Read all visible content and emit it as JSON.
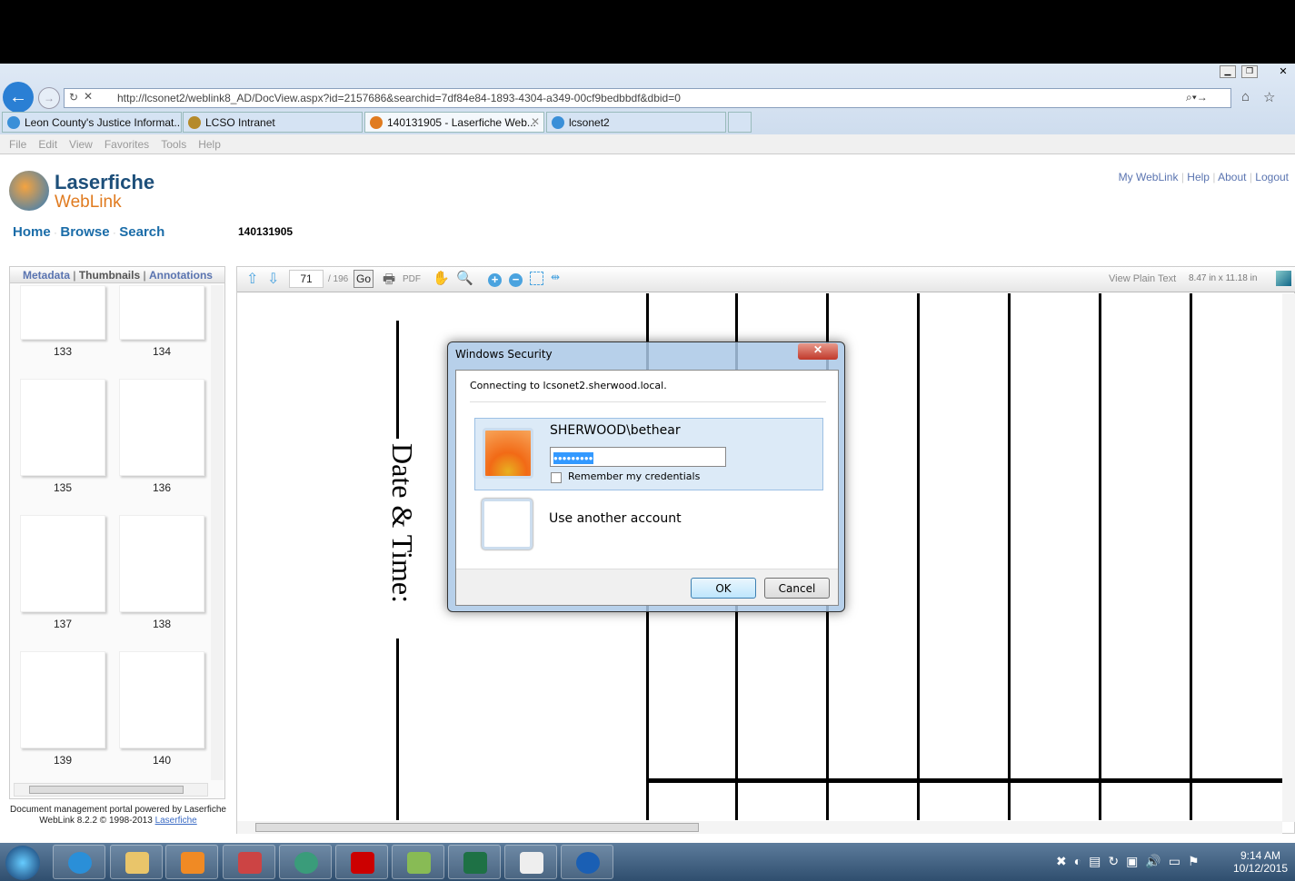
{
  "browser": {
    "url": "http://lcsonet2/weblink8_AD/DocView.aspx?id=2157686&searchid=7df84e84-1893-4304-a349-00cf9bedbbdf&dbid=0",
    "tabs": [
      {
        "label": "Leon County's Justice Informat..."
      },
      {
        "label": "LCSO Intranet"
      },
      {
        "label": "140131905 - Laserfiche Web...",
        "active": true
      },
      {
        "label": "lcsonet2"
      }
    ],
    "menu": [
      "File",
      "Edit",
      "View",
      "Favorites",
      "Tools",
      "Help"
    ]
  },
  "header": {
    "logo_top": "Laserfiche",
    "logo_bottom": "WebLink",
    "top_links": [
      "My WebLink",
      "Help",
      "About",
      "Logout"
    ],
    "nav": [
      "Home",
      "Browse",
      "Search"
    ],
    "doc_name": "140131905"
  },
  "left_panel": {
    "tabs": [
      "Metadata",
      "Thumbnails",
      "Annotations"
    ],
    "thumbnails": [
      "133",
      "134",
      "135",
      "136",
      "137",
      "138",
      "139",
      "140"
    ],
    "footer_line1": "Document management portal powered by Laserfiche",
    "footer_line2": "WebLink 8.2.2 © 1998-2013 ",
    "footer_link": "Laserfiche"
  },
  "viewer": {
    "page": "71",
    "page_total": "/ 196",
    "go": "Go",
    "pdf": "PDF",
    "view_plain_text": "View Plain Text",
    "page_size": "8.47 in x 11.18 in",
    "doc_text": "Date & Time:"
  },
  "dialog": {
    "title": "Windows Security",
    "connecting": "Connecting to lcsonet2.sherwood.local.",
    "username": "SHERWOOD\\bethear",
    "password": "●●●●●●●●●",
    "remember": "Remember my credentials",
    "remember_checked": false,
    "other": "Use another account",
    "ok": "OK",
    "cancel": "Cancel"
  },
  "taskbar": {
    "time": "9:14 AM",
    "date": "10/12/2015"
  }
}
